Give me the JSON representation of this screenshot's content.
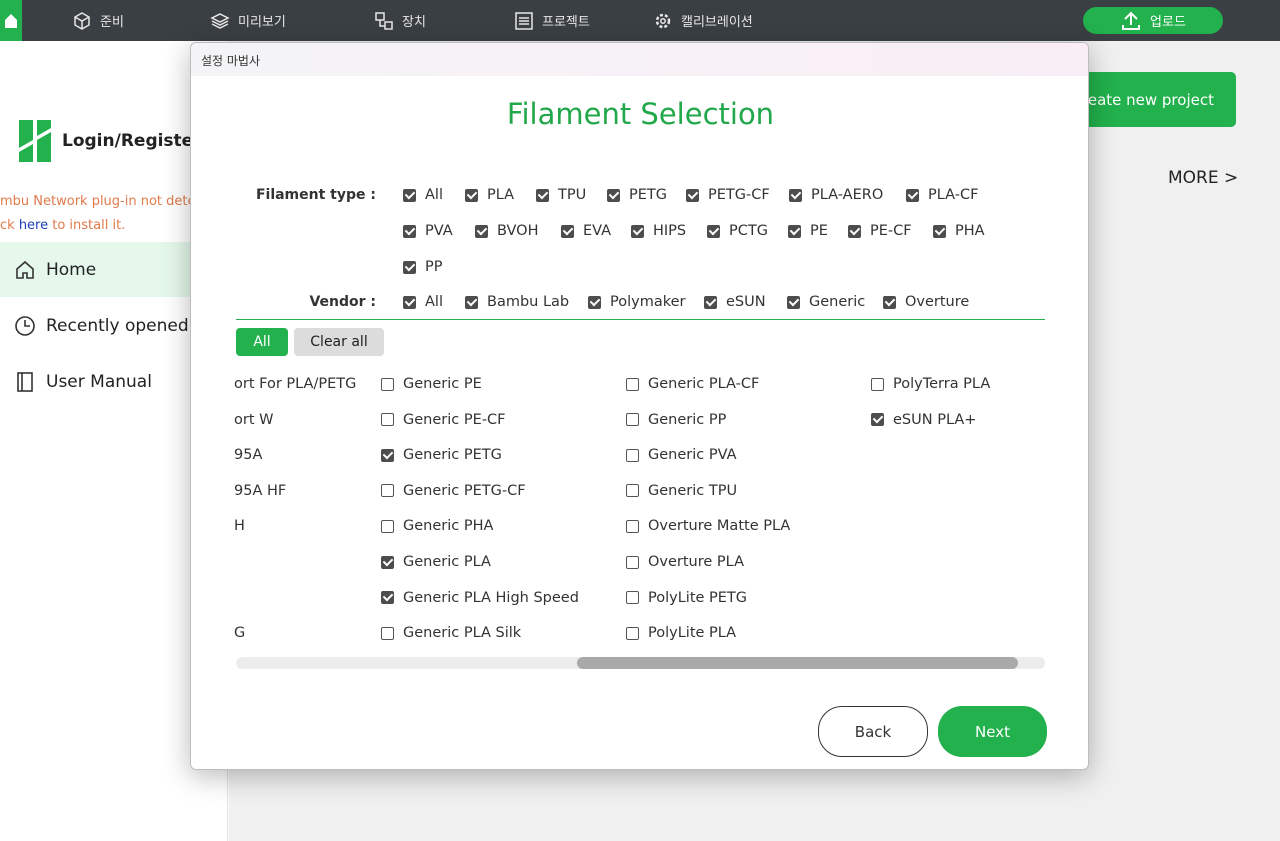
{
  "topbar": {
    "tabs": [
      {
        "label": "준비",
        "icon": "cube-icon"
      },
      {
        "label": "미리보기",
        "icon": "layers-icon"
      },
      {
        "label": "장치",
        "icon": "device-icon"
      },
      {
        "label": "프로젝트",
        "icon": "list-icon"
      },
      {
        "label": "캘리브레이션",
        "icon": "gear-icon"
      }
    ],
    "upload_label": "업로드"
  },
  "sidebar": {
    "login_label": "Login/Register",
    "warning_line1": "mbu Network plug-in not detec",
    "warning_line2_prefix": "ck ",
    "warning_link": "here",
    "warning_line2_suffix": " to install it.",
    "items": [
      {
        "label": "Home",
        "icon": "home-icon"
      },
      {
        "label": "Recently opened",
        "icon": "clock-icon"
      },
      {
        "label": "User Manual",
        "icon": "book-icon"
      }
    ]
  },
  "main": {
    "create_project_label": "reate new project",
    "more_label": "MORE >"
  },
  "dialog": {
    "window_title": "설정 마법사",
    "heading": "Filament Selection",
    "filament_type_label": "Filament type :",
    "filament_types": [
      "All",
      "PLA",
      "TPU",
      "PETG",
      "PETG-CF",
      "PLA-AERO",
      "PLA-CF",
      "PVA",
      "BVOH",
      "EVA",
      "HIPS",
      "PCTG",
      "PE",
      "PE-CF",
      "PHA",
      "PP"
    ],
    "vendor_label": "Vendor :",
    "vendors": [
      "All",
      "Bambu Lab",
      "Polymaker",
      "eSUN",
      "Generic",
      "Overture"
    ],
    "all_button": "All",
    "clear_all_button": "Clear all",
    "clipped_column": [
      "ort For PLA/PETG",
      "ort W",
      "95A",
      "95A HF",
      "H",
      "",
      "",
      "G"
    ],
    "column2": [
      {
        "label": "Generic PE",
        "checked": false
      },
      {
        "label": "Generic PE-CF",
        "checked": false
      },
      {
        "label": "Generic PETG",
        "checked": true
      },
      {
        "label": "Generic PETG-CF",
        "checked": false
      },
      {
        "label": "Generic PHA",
        "checked": false
      },
      {
        "label": "Generic PLA",
        "checked": true
      },
      {
        "label": "Generic PLA High Speed",
        "checked": true
      },
      {
        "label": "Generic PLA Silk",
        "checked": false
      }
    ],
    "column3": [
      {
        "label": "Generic PLA-CF",
        "checked": false
      },
      {
        "label": "Generic PP",
        "checked": false
      },
      {
        "label": "Generic PVA",
        "checked": false
      },
      {
        "label": "Generic TPU",
        "checked": false
      },
      {
        "label": "Overture Matte PLA",
        "checked": false
      },
      {
        "label": "Overture PLA",
        "checked": false
      },
      {
        "label": "PolyLite PETG",
        "checked": false
      },
      {
        "label": "PolyLite PLA",
        "checked": false
      }
    ],
    "column4": [
      {
        "label": "PolyTerra PLA",
        "checked": false
      },
      {
        "label": "eSUN PLA+",
        "checked": true
      }
    ],
    "back_button": "Back",
    "next_button": "Next"
  },
  "colors": {
    "accent": "#22b14c",
    "topbar": "#3a3f43",
    "warning": "#e07a4b"
  }
}
